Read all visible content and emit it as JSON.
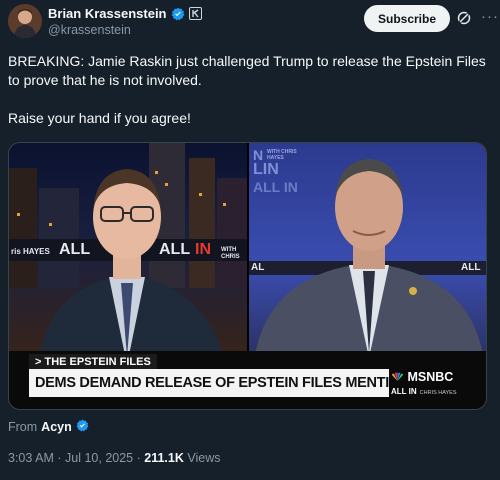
{
  "author": {
    "name": "Brian Krassenstein",
    "handle": "@krassenstein"
  },
  "header": {
    "subscribe_label": "Subscribe",
    "more_label": "···"
  },
  "tweet": {
    "paragraphs": [
      "BREAKING: Jamie Raskin just challenged Trump to release the Epstein Files to prove that he is not involved.",
      "Raise your hand if you agree!"
    ]
  },
  "media": {
    "wall_left_1": "ris HAYES",
    "wall_left_2": "ALL",
    "wall_left_3": "ALL",
    "wall_left_4": "IN",
    "wall_left_5": "WITH CHRIS",
    "wall_right_1": "N",
    "wall_right_2": "LIN",
    "wall_right_3": "ALL IN",
    "wall_right_4": "WITH CHRIS HAYES",
    "wall_right_5": "AL",
    "wall_right_6": "ALL",
    "segment_tag": "> THE EPSTEIN FILES",
    "chyron": "DEMS DEMAND RELEASE OF EPSTEIN FILES MENTIONING TRUMP",
    "network": "MSNBC",
    "show": "ALL IN",
    "show_host": "CHRIS HAYES"
  },
  "source": {
    "prefix": "From",
    "account": "Acyn"
  },
  "meta": {
    "time": "3:03 AM",
    "separator": "·",
    "date": "Jul 10, 2025",
    "views_count": "211.1K",
    "views_label": "Views"
  },
  "colors": {
    "background": "#15202b",
    "verified_blue": "#1d9bf0",
    "secondary_text": "#8b98a5"
  }
}
